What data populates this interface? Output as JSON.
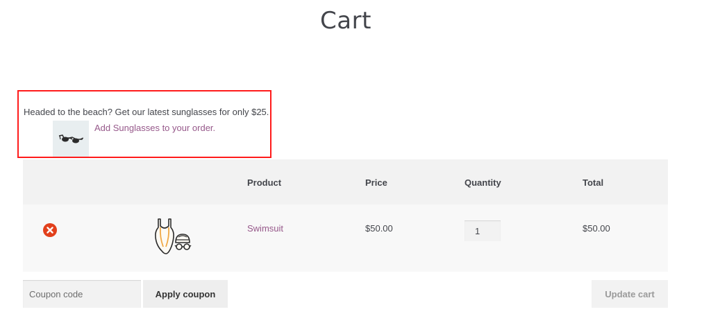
{
  "page": {
    "title": "Cart"
  },
  "upsell": {
    "message": "Headed to the beach? Get our latest sunglasses for only $25.",
    "link_label": "Add Sunglasses to your order.",
    "highlight_color": "#ff1a1a"
  },
  "table": {
    "headers": {
      "product": "Product",
      "price": "Price",
      "quantity": "Quantity",
      "total": "Total"
    },
    "rows": [
      {
        "product": "Swimsuit",
        "price": "$50.00",
        "quantity": "1",
        "total": "$50.00"
      }
    ]
  },
  "actions": {
    "coupon_placeholder": "Coupon code",
    "apply_label": "Apply coupon",
    "update_label": "Update cart"
  },
  "colors": {
    "link": "#96588a",
    "remove": "#e2401c",
    "header_bg": "#f2f2f2"
  },
  "icons": {
    "remove": "remove-circle-icon",
    "upsell_thumb": "sunglasses-icon",
    "product_thumb": "swimsuit-icon"
  }
}
